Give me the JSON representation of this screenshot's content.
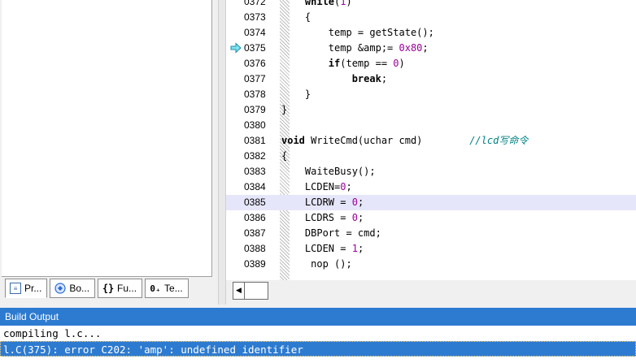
{
  "project_tabs": [
    {
      "label": "Pr...",
      "icon": "project-window-icon"
    },
    {
      "label": "Bo...",
      "icon": "books-icon"
    },
    {
      "label": "Fu...",
      "icon": "functions-icon",
      "glyph": "{}"
    },
    {
      "label": "Te...",
      "icon": "templates-icon",
      "glyph": "0₊"
    }
  ],
  "editor": {
    "lines": [
      {
        "num": "0372",
        "code": "    while(1)"
      },
      {
        "num": "0373",
        "code": "    {"
      },
      {
        "num": "0374",
        "code": "        temp = getState();"
      },
      {
        "num": "0375",
        "code": "        temp &amp;= 0x80;",
        "marker": "error-arrow-icon"
      },
      {
        "num": "0376",
        "code": "        if(temp == 0)"
      },
      {
        "num": "0377",
        "code": "            break;"
      },
      {
        "num": "0378",
        "code": "    }"
      },
      {
        "num": "0379",
        "code": "}"
      },
      {
        "num": "0380",
        "code": ""
      },
      {
        "num": "0381",
        "code": "void WriteCmd(uchar cmd)        //lcd写命令"
      },
      {
        "num": "0382",
        "code": "{"
      },
      {
        "num": "0383",
        "code": "    WaiteBusy();"
      },
      {
        "num": "0384",
        "code": "    LCDEN=0;"
      },
      {
        "num": "0385",
        "code": "    LCDRW = 0;",
        "highlighted": true
      },
      {
        "num": "0386",
        "code": "    LCDRS = 0;"
      },
      {
        "num": "0387",
        "code": "    DBPort = cmd;"
      },
      {
        "num": "0388",
        "code": "    LCDEN = 1;"
      },
      {
        "num": "0389",
        "code": "     nop ();"
      }
    ],
    "highlight_color": "#e6e6fa"
  },
  "build_output": {
    "title": "Build Output",
    "lines": [
      {
        "text": "compiling l.c..."
      },
      {
        "text": "l.C(375): error C202: 'amp': undefined identifier",
        "selected": true
      }
    ],
    "accent": "#2d7bd0"
  }
}
